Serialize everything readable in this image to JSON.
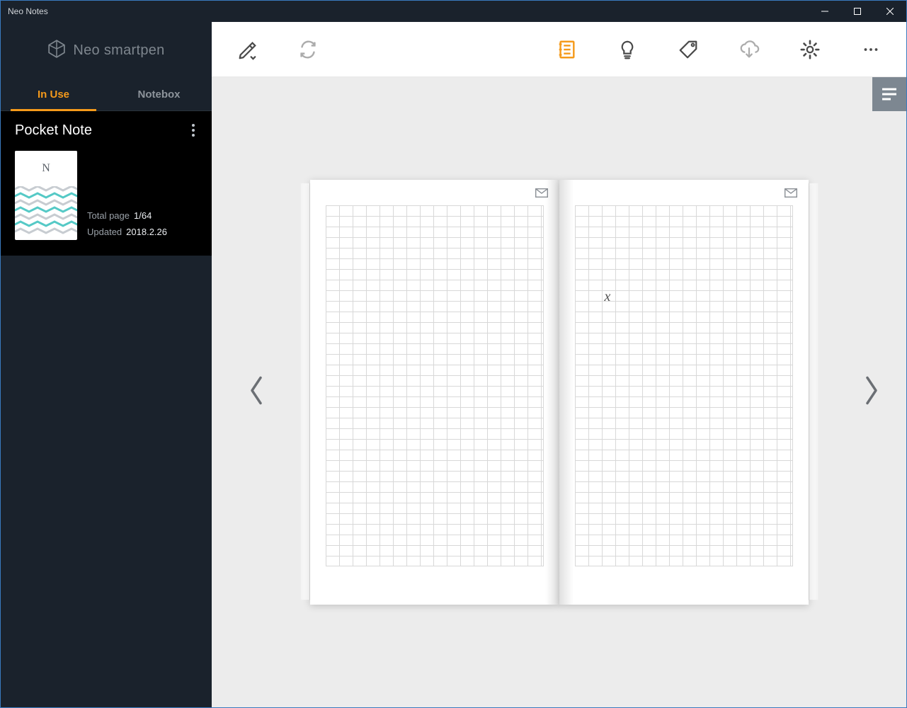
{
  "window": {
    "title": "Neo Notes"
  },
  "brand": {
    "text": "Neo smartpen"
  },
  "tabs": {
    "in_use": "In Use",
    "notebox": "Notebox"
  },
  "notebook": {
    "title": "Pocket Note",
    "thumb_letter": "N",
    "total_page_label": "Total page",
    "total_page_value": "1/64",
    "updated_label": "Updated",
    "updated_value": "2018.2.26"
  },
  "toolbar": {
    "pen": "pen-icon",
    "sync": "sync-icon",
    "notebook": "notebook-icon",
    "idea": "idea-icon",
    "tag": "tag-icon",
    "cloud": "cloud-download-icon",
    "settings": "settings-icon",
    "more": "more-icon"
  },
  "viewer": {
    "ink_sample": "x"
  },
  "colors": {
    "accent": "#f59a1b"
  }
}
